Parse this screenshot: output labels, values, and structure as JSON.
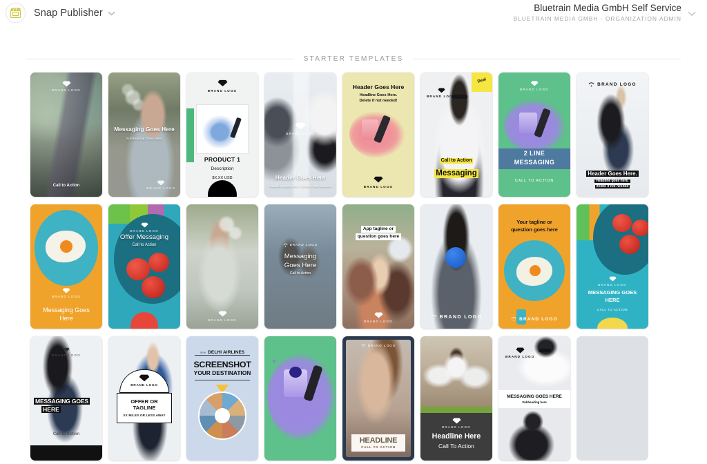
{
  "topbar": {
    "logo_icon": "clapperboard-icon",
    "app_name": "Snap Publisher",
    "app_caret_icon": "chevron-down-icon",
    "org_title": "Bluetrain Media GmbH Self Service",
    "org_subtitle": "BLUETRAIN MEDIA GMBH - ORGANIZATION ADMIN",
    "org_caret_icon": "chevron-down-icon"
  },
  "section": {
    "title": "STARTER TEMPLATES"
  },
  "colors": {
    "page_bg": "#ffffff",
    "rule": "#e6e6e8",
    "section_label": "#9b9ba1",
    "logo_yellow": "#d8cf4a",
    "card_placeholder": "#dde0e4",
    "accent_yellow": "#f5e642",
    "green": "#5ec08a",
    "teal": "#2fb3c4",
    "orange": "#f0a32a",
    "purple": "#9b89e0",
    "navy": "#2b3a4f"
  },
  "templates": [
    {
      "id": 1,
      "name": "shop-girl-phone",
      "style": "photo-shop",
      "brand_logo": "BRAND LOGO",
      "lines": [
        {
          "text": "Call to Action",
          "role": "cta"
        }
      ]
    },
    {
      "id": 2,
      "name": "bubbles-messaging",
      "style": "photo-bubble",
      "brand_logo": "BRAND LOGO",
      "lines": [
        {
          "text": "Messaging Goes Here",
          "role": "headline"
        },
        {
          "text": "Subheading Goes Here",
          "role": "subheadline"
        }
      ]
    },
    {
      "id": 3,
      "name": "product-card",
      "style": "product",
      "brand_logo": "BRAND LOGO",
      "lines": [
        {
          "text": "PRODUCT 1",
          "role": "title"
        },
        {
          "text": "Description",
          "role": "description"
        },
        {
          "text": "$X.XX USD",
          "role": "price"
        }
      ]
    },
    {
      "id": 4,
      "name": "model-header",
      "style": "photo-model",
      "brand_logo": "BRAND LOGO",
      "lines": [
        {
          "text": "Header Goes Here",
          "role": "headline"
        },
        {
          "text": "Headline Goes Here. Delete if not needed!",
          "role": "subheadline"
        }
      ]
    },
    {
      "id": 5,
      "name": "nail-polish-yellow",
      "style": "yellow-product",
      "brand_logo": "BRAND LOGO",
      "lines": [
        {
          "text": "Header Goes Here",
          "role": "headline"
        },
        {
          "text": "Headline Goes Here.",
          "role": "subheadline"
        },
        {
          "text": "Delete if not needed!",
          "role": "subheadline2"
        }
      ]
    },
    {
      "id": 6,
      "name": "sunglasses-deal",
      "style": "deal",
      "brand_logo": "BRAND LOGO",
      "lines": [
        {
          "text": "Deal",
          "role": "badge"
        },
        {
          "text": "Call to Action",
          "role": "cta"
        },
        {
          "text": "Messaging",
          "role": "headline"
        }
      ]
    },
    {
      "id": 7,
      "name": "two-line-messaging-green",
      "style": "green-product",
      "brand_logo": "BRAND LOGO",
      "lines": [
        {
          "text": "2 LINE",
          "role": "headline"
        },
        {
          "text": "MESSAGING",
          "role": "headline2"
        },
        {
          "text": "CALL TO ACTION",
          "role": "cta"
        }
      ]
    },
    {
      "id": 8,
      "name": "jumping-man-header",
      "style": "photo-jump",
      "brand_logo": "BRAND LOGO",
      "lines": [
        {
          "text": "Header Goes Here.",
          "role": "headline"
        },
        {
          "text": "Headline goes here.",
          "role": "subheadline"
        },
        {
          "text": "delete if not needed",
          "role": "subheadline2"
        }
      ]
    },
    {
      "id": 9,
      "name": "egg-pan-orange",
      "style": "egg-orange",
      "brand_logo": "BRAND LOGO",
      "lines": [
        {
          "text": "Messaging Goes",
          "role": "headline"
        },
        {
          "text": "Here",
          "role": "headline2"
        }
      ]
    },
    {
      "id": 10,
      "name": "tomatoes-offer",
      "style": "tomato-teal",
      "brand_logo": "BRAND LOGO",
      "lines": [
        {
          "text": "Offer Messaging",
          "role": "headline"
        },
        {
          "text": "Call to Action",
          "role": "cta"
        }
      ]
    },
    {
      "id": 11,
      "name": "bubbles-plain",
      "style": "photo-bubble2",
      "brand_logo": "BRAND LOGO",
      "lines": []
    },
    {
      "id": 12,
      "name": "stairs-messaging",
      "style": "photo-stairs",
      "brand_logo": "BRAND LOGO",
      "lines": [
        {
          "text": "Messaging",
          "role": "headline"
        },
        {
          "text": "Goes Here",
          "role": "headline2"
        },
        {
          "text": "Call to Action",
          "role": "cta"
        }
      ]
    },
    {
      "id": 13,
      "name": "beach-friends-tagline",
      "style": "photo-beach",
      "brand_logo": "BRAND LOGO",
      "lines": [
        {
          "text": "App tagline or",
          "role": "headline"
        },
        {
          "text": "question goes here",
          "role": "headline2"
        }
      ]
    },
    {
      "id": 14,
      "name": "balloon-brand-logo",
      "style": "photo-balloon",
      "brand_logo": "BRAND LOGO",
      "lines": []
    },
    {
      "id": 15,
      "name": "egg-pan-tagline",
      "style": "egg-orange2",
      "brand_logo": "BRAND LOGO",
      "lines": [
        {
          "text": "Your tagline or",
          "role": "headline"
        },
        {
          "text": "question goes here",
          "role": "headline2"
        }
      ]
    },
    {
      "id": 16,
      "name": "tomatoes-messaging",
      "style": "tomato-teal2",
      "brand_logo": "BRAND LOGO",
      "lines": [
        {
          "text": "MESSAGING GOES",
          "role": "headline"
        },
        {
          "text": "HERE",
          "role": "headline2"
        },
        {
          "text": "CALL TO ACTION",
          "role": "cta"
        }
      ]
    },
    {
      "id": 17,
      "name": "split-jump-messaging",
      "style": "photo-splitjump",
      "brand_logo": "BRAND LOGO",
      "lines": [
        {
          "text": "MESSAGING GOES",
          "role": "headline"
        },
        {
          "text": "HERE",
          "role": "headline2"
        },
        {
          "text": "Call to Action",
          "role": "cta"
        }
      ]
    },
    {
      "id": 18,
      "name": "offer-or-tagline",
      "style": "offer-badge",
      "brand_logo": "BRAND LOGO",
      "lines": [
        {
          "text": "OFFER OR",
          "role": "headline"
        },
        {
          "text": "TAGLINE",
          "role": "headline2"
        },
        {
          "text": "XX MILES OR LESS AWAY",
          "role": "cta"
        }
      ]
    },
    {
      "id": 19,
      "name": "screenshot-destination",
      "style": "airlines",
      "brand_logo": "DELHI AIRLINES",
      "lines": [
        {
          "text": "new",
          "role": "eyebrow"
        },
        {
          "text": "DELHI AIRLINES",
          "role": "brand"
        },
        {
          "text": "SCREENSHOT",
          "role": "headline"
        },
        {
          "text": "YOUR DESTINATION",
          "role": "headline2"
        }
      ]
    },
    {
      "id": 20,
      "name": "purple-polish-green",
      "style": "purple-green",
      "brand_logo": "",
      "lines": []
    },
    {
      "id": 21,
      "name": "beauty-headline",
      "style": "beauty",
      "brand_logo": "BRAND LOGO",
      "lines": [
        {
          "text": "HEADLINE",
          "role": "headline"
        },
        {
          "text": "CALL TO ACTION",
          "role": "cta"
        }
      ]
    },
    {
      "id": 22,
      "name": "classroom-headline",
      "style": "classroom",
      "brand_logo": "BRAND LOGO",
      "lines": [
        {
          "text": "Headline Here",
          "role": "headline"
        },
        {
          "text": "Call To Action",
          "role": "cta"
        }
      ]
    },
    {
      "id": 23,
      "name": "split-messaging-subheading",
      "style": "split-white",
      "brand_logo": "BRAND LOGO",
      "lines": [
        {
          "text": "MESSAGING GOES HERE",
          "role": "headline"
        },
        {
          "text": "Subheading here",
          "role": "subheadline"
        }
      ]
    },
    {
      "id": 24,
      "name": "placeholder-empty",
      "style": "empty",
      "brand_logo": "",
      "lines": []
    }
  ]
}
